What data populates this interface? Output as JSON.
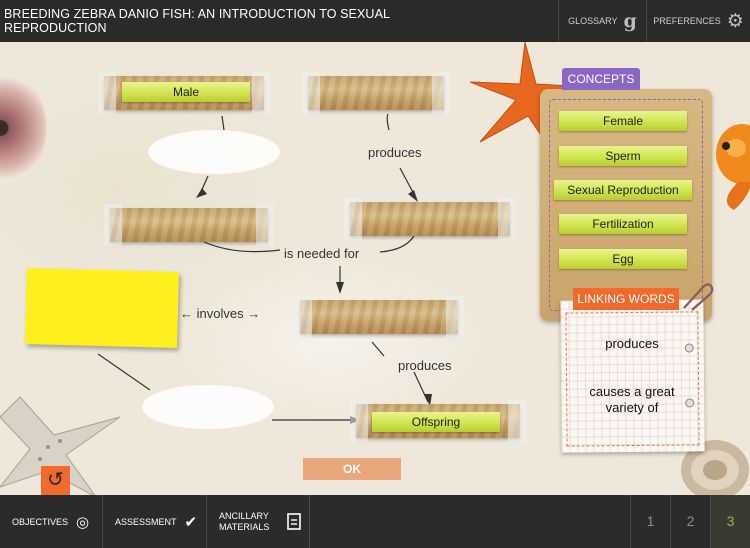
{
  "header": {
    "title": "BREEDING ZEBRA DANIO FISH: AN INTRODUCTION TO SEXUAL REPRODUCTION",
    "glossary_label": "GLOSSARY",
    "preferences_label": "PREFERENCES"
  },
  "map": {
    "nodes": [
      {
        "id": "male",
        "label": "Male"
      },
      {
        "id": "top-middle",
        "label": ""
      },
      {
        "id": "mid-left",
        "label": ""
      },
      {
        "id": "mid-right",
        "label": ""
      },
      {
        "id": "center",
        "label": ""
      },
      {
        "id": "offspring",
        "label": "Offspring"
      }
    ],
    "links": {
      "produces_top": "produces",
      "is_needed_for": "is needed for",
      "involves": "involves",
      "produces_bottom": "produces"
    },
    "ok_label": "OK"
  },
  "concepts": {
    "tab_label": "CONCEPTS",
    "items": [
      "Female",
      "Sperm",
      "Sexual Reproduction",
      "Fertilization",
      "Egg"
    ]
  },
  "linking_words": {
    "tab_label": "LINKING WORDS",
    "items": [
      "produces",
      "causes a great variety of"
    ]
  },
  "footer": {
    "objectives_label": "OBJECTIVES",
    "assessment_label": "ASSESSMENT",
    "ancillary_label": "ANCILLARY MATERIALS",
    "pages": [
      "1",
      "2",
      "3"
    ],
    "current_page": "3"
  },
  "colors": {
    "concept_tab": "#8a67c6",
    "linking_tab": "#f06a2c",
    "chip": "#cfe24a",
    "sticky_note": "#ffef1c",
    "ok_button": "#e9a77a",
    "active_page": "#a6b23e"
  },
  "icons": {
    "glossary": "g-icon",
    "preferences": "gear-icon",
    "reset": "reset-icon",
    "objectives": "target-icon",
    "assessment": "checkmark-icon",
    "ancillary": "document-icon"
  }
}
